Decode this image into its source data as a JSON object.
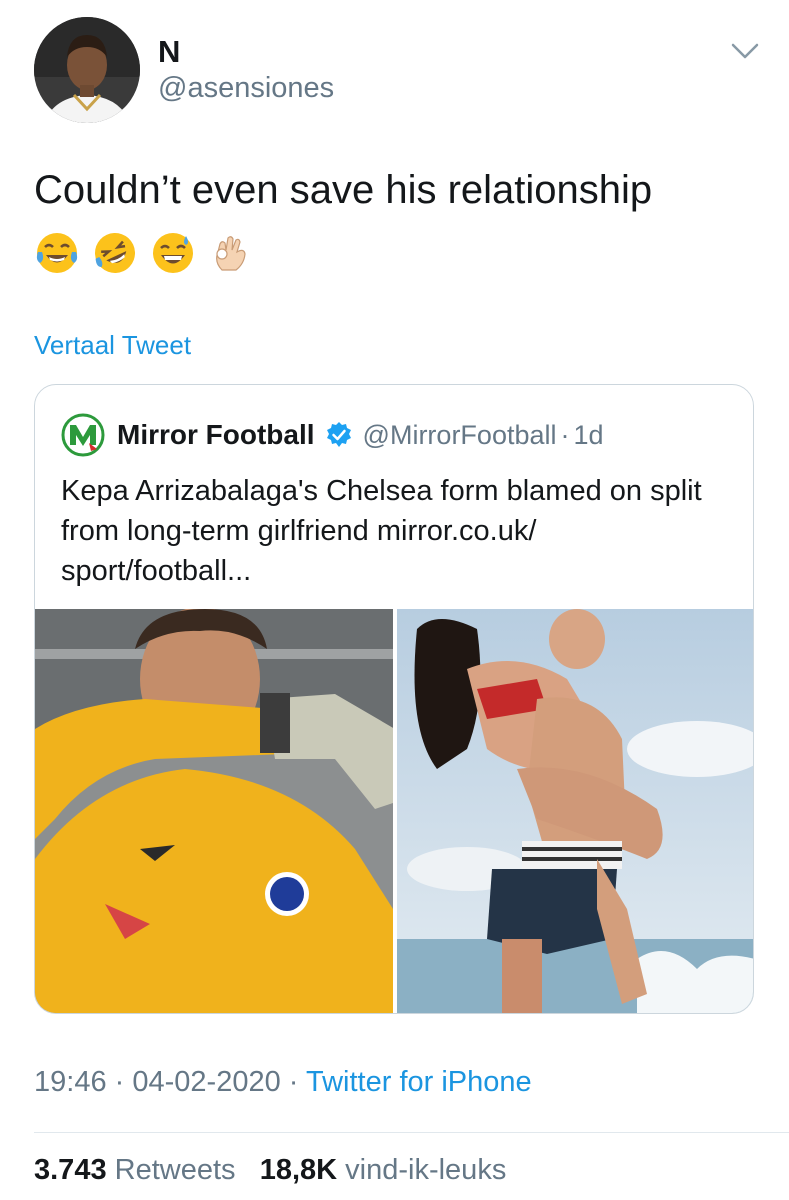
{
  "author": {
    "display_name": "N",
    "handle": "@asensiones",
    "avatar_icon": "profile-photo"
  },
  "tweet": {
    "text": "Couldn’t even save his relationship",
    "emojis": [
      "face-with-tears-of-joy",
      "rolling-on-the-floor-laughing",
      "grinning-face-with-sweat",
      "ok-hand-light-skin-tone"
    ],
    "translate_label": "Vertaal Tweet"
  },
  "quoted_tweet": {
    "display_name": "Mirror Football",
    "handle": "@MirrorFootball",
    "separator": "·",
    "time": "1d",
    "verified_icon": "verified-badge-icon",
    "logo_icon": "mirror-football-logo",
    "text": "Kepa Arrizabalaga's Chelsea form blamed on split from long-term girlfriend mirror.co.uk/ sport/football...",
    "photos": [
      "goalkeeper-in-yellow-kit-photo",
      "couple-at-sea-photo"
    ]
  },
  "meta": {
    "time": "19:46",
    "separator": "·",
    "date": "04-02-2020",
    "source": "Twitter for iPhone"
  },
  "stats": {
    "retweets_count": "3.743",
    "retweets_label": "Retweets",
    "likes_count": "18,8K",
    "likes_label": "vind-ik-leuks"
  },
  "colors": {
    "link_blue": "#1b95e0",
    "secondary_text": "#657786",
    "primary_text": "#14171a",
    "border": "#ccd6dd"
  }
}
